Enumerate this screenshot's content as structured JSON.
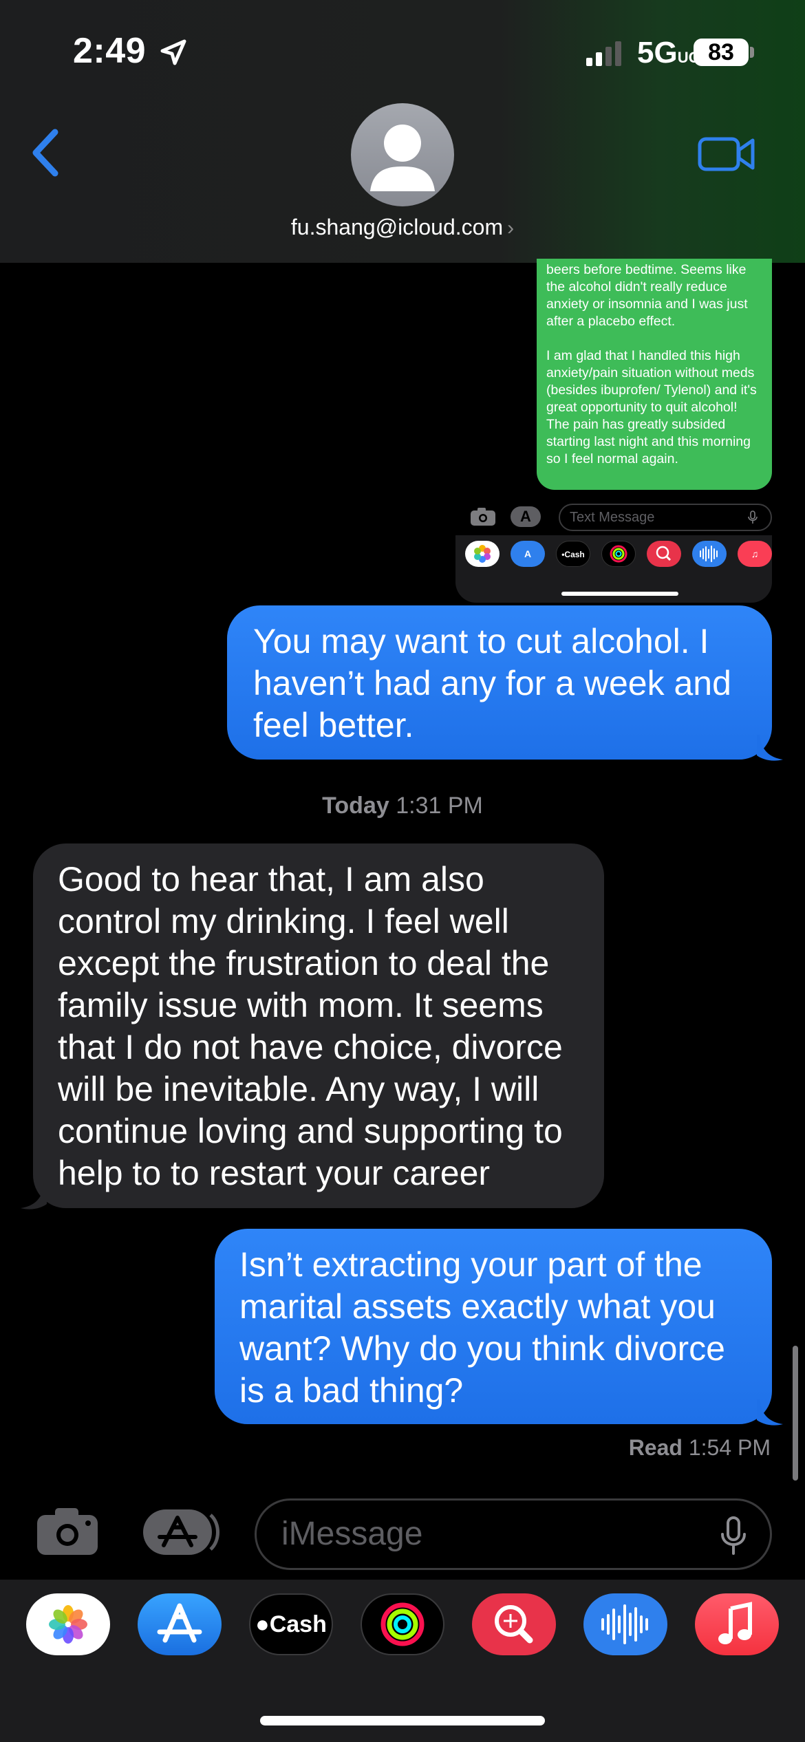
{
  "status_bar": {
    "time": "2:49",
    "network": "5G",
    "network_suffix": "UC",
    "battery": "83"
  },
  "header": {
    "contact": "fu.shang@icloud.com",
    "contact_chevron": "›"
  },
  "embedded_screenshot": {
    "green_message_p1": "beers before bedtime. Seems like the alcohol didn't really reduce anxiety or insomnia and I was just after a placebo effect.",
    "green_message_p2": "I am glad that I handled this high anxiety/pain situation without meds (besides ibuprofen/ Tylenol) and it's great opportunity to quit alcohol! The pain has greatly subsided starting last night and this morning so I feel normal again.",
    "input_placeholder": "Text Message",
    "cash_label": "Cash"
  },
  "messages": [
    {
      "direction": "sent",
      "text": "You may want to cut alcohol. I haven’t had any for a week and feel better."
    },
    {
      "direction": "received",
      "text": "Good to hear that, I am also control my drinking. I feel well except the frustration to deal the family issue with mom. It seems that I do not have choice, divorce will be inevitable. Any way, I will continue loving and supporting to help to to restart your career"
    },
    {
      "direction": "sent",
      "text": "Isn’t extracting your part of the marital assets exactly what you want? Why do you think divorce is a bad thing?"
    }
  ],
  "timestamp": {
    "day": "Today",
    "time": "1:31 PM"
  },
  "receipt": {
    "label": "Read",
    "time": "1:54 PM"
  },
  "composer": {
    "placeholder": "iMessage"
  },
  "app_drawer": {
    "icons": [
      "photos-icon",
      "app-store-icon",
      "apple-cash-icon",
      "activity-icon",
      "image-search-icon",
      "audio-message-icon",
      "music-icon"
    ],
    "cash_label": "Cash"
  },
  "colors": {
    "sent_bubble": "#2f85f8",
    "received_bubble": "#262629",
    "green_bubble": "#3ebc58",
    "accent": "#2f80ed"
  }
}
